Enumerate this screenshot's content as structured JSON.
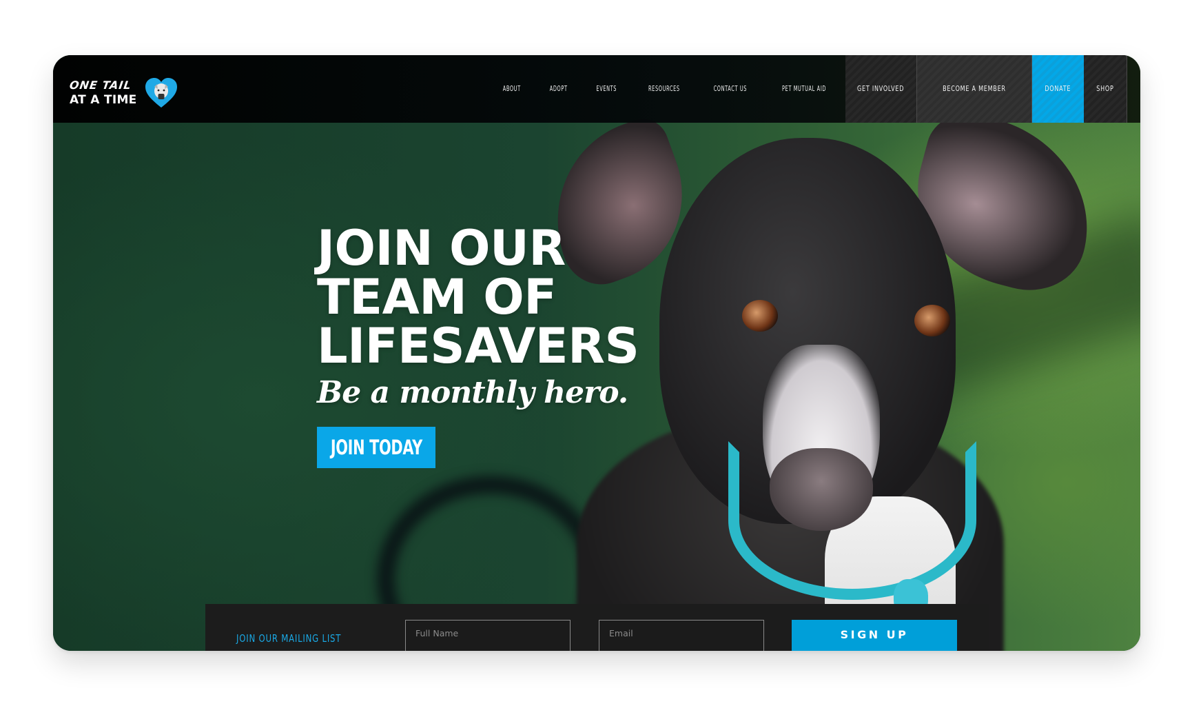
{
  "logo": {
    "line1": "ONE TAIL",
    "line2": "AT A TIME",
    "heart_color": "#1fa9e6",
    "icon": "heart-dog-icon"
  },
  "nav": {
    "items": [
      {
        "label": "ABOUT"
      },
      {
        "label": "ADOPT"
      },
      {
        "label": "EVENTS"
      },
      {
        "label": "RESOURCES"
      },
      {
        "label": "CONTACT US"
      },
      {
        "label": "PET MUTUAL AID"
      },
      {
        "label": "GET INVOLVED"
      },
      {
        "label": "BECOME A MEMBER"
      },
      {
        "label": "DONATE"
      },
      {
        "label": "SHOP"
      }
    ]
  },
  "hero": {
    "headline": [
      "JOIN OUR",
      "TEAM OF",
      "LIFESAVERS"
    ],
    "tagline": "Be a monthly hero.",
    "cta_label": "JOIN TODAY",
    "image_alt": "Black and white dog with teal collar on grass"
  },
  "mailing": {
    "heading": "JOIN OUR MAILING LIST",
    "fullname_placeholder": "Full Name",
    "fullname_value": "",
    "email_placeholder": "Email",
    "email_value": "",
    "signup_label": "SIGN UP"
  },
  "colors": {
    "accent": "#0aa7e8",
    "signup": "#009fd9",
    "mailing_bar": "#1c1c1c",
    "nav_bg": "#000000"
  }
}
